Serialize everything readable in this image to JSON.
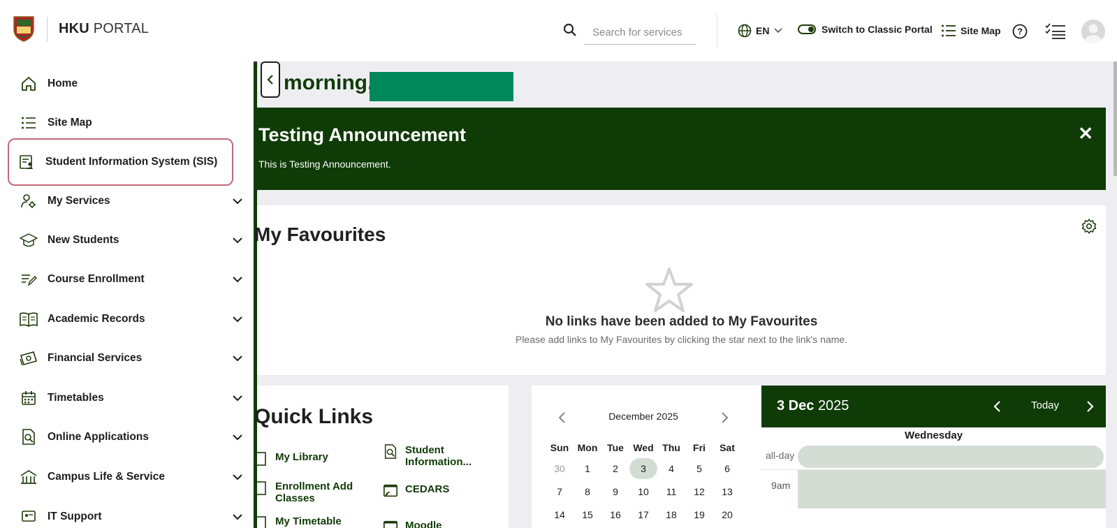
{
  "brand": {
    "bold": "HKU",
    "light": "PORTAL"
  },
  "header": {
    "search_placeholder": "Search for services",
    "lang": "EN",
    "classic": "Switch to Classic Portal",
    "sitemap": "Site Map"
  },
  "sidebar": {
    "items": [
      {
        "label": "Home",
        "icon": "home-icon"
      },
      {
        "label": "Site Map",
        "icon": "list-icon"
      },
      {
        "label": "Student Information System (SIS)",
        "icon": "sis-icon"
      },
      {
        "label": "My Services",
        "icon": "user-gear-icon"
      },
      {
        "label": "New Students",
        "icon": "graduation-cap-icon"
      },
      {
        "label": "Course Enrollment",
        "icon": "edit-list-icon"
      },
      {
        "label": "Academic Records",
        "icon": "book-icon"
      },
      {
        "label": "Financial Services",
        "icon": "money-icon"
      },
      {
        "label": "Timetables",
        "icon": "calendar-icon"
      },
      {
        "label": "Online Applications",
        "icon": "document-search-icon"
      },
      {
        "label": "Campus Life & Service",
        "icon": "building-icon"
      },
      {
        "label": "IT Support",
        "icon": "it-icon"
      }
    ]
  },
  "greeting": {
    "text": "morning,"
  },
  "announcement": {
    "title": "Testing Announcement",
    "body": "This is Testing Announcement.",
    "close": "✕"
  },
  "favourites": {
    "title": "My Favourites",
    "empty_title": "No links have been added to My Favourites",
    "empty_sub": "Please add links to My Favourites by clicking the star next to the link's name."
  },
  "quick_links": {
    "title": "Quick Links",
    "items": [
      {
        "label": "My Library"
      },
      {
        "label": "Student\nInformation..."
      },
      {
        "label": "Enrollment Add\nClasses"
      },
      {
        "label": "CEDARS"
      },
      {
        "label": "My Timetable"
      },
      {
        "label": "Moodle"
      }
    ]
  },
  "calendar": {
    "month": "December 2025",
    "weekdays": [
      "Sun",
      "Mon",
      "Tue",
      "Wed",
      "Thu",
      "Fri",
      "Sat"
    ],
    "weeks": [
      [
        "30",
        "1",
        "2",
        "3",
        "4",
        "5",
        "6"
      ],
      [
        "7",
        "8",
        "9",
        "10",
        "11",
        "12",
        "13"
      ],
      [
        "14",
        "15",
        "16",
        "17",
        "18",
        "19",
        "20"
      ]
    ],
    "day_title_bold": "3 Dec",
    "day_title_year": "2025",
    "today_label": "Today",
    "weekday": "Wednesday",
    "allday": "all-day",
    "slot": "9am"
  }
}
